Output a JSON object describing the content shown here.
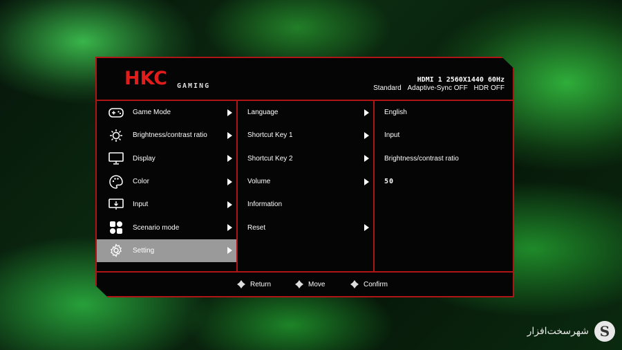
{
  "header": {
    "logo": "HKC",
    "logo_sub": "GAMING",
    "signal": "HDMI 1 2560X1440 60Hz",
    "status": [
      "Standard",
      "Adaptive-Sync OFF",
      "HDR OFF"
    ]
  },
  "main_menu": [
    {
      "label": "Game Mode",
      "icon": "gamepad-icon"
    },
    {
      "label": "Brightness/contrast ratio",
      "icon": "sun-icon"
    },
    {
      "label": "Display",
      "icon": "monitor-icon"
    },
    {
      "label": "Color",
      "icon": "palette-icon"
    },
    {
      "label": "Input",
      "icon": "input-icon"
    },
    {
      "label": "Scenario mode",
      "icon": "grid-icon"
    },
    {
      "label": "Setting",
      "icon": "gear-icon",
      "selected": true
    }
  ],
  "sub_menu": [
    {
      "label": "Language",
      "arrow": true
    },
    {
      "label": "Shortcut Key 1",
      "arrow": true
    },
    {
      "label": "Shortcut Key 2",
      "arrow": true
    },
    {
      "label": "Volume",
      "arrow": true
    },
    {
      "label": "Information",
      "arrow": false
    },
    {
      "label": "Reset",
      "arrow": true
    }
  ],
  "values": [
    "English",
    "Input",
    "Brightness/contrast ratio",
    "50"
  ],
  "footer": {
    "return": "Return",
    "move": "Move",
    "confirm": "Confirm"
  },
  "watermark": {
    "text": "شهرسخت‌افزار",
    "logo": "S"
  }
}
